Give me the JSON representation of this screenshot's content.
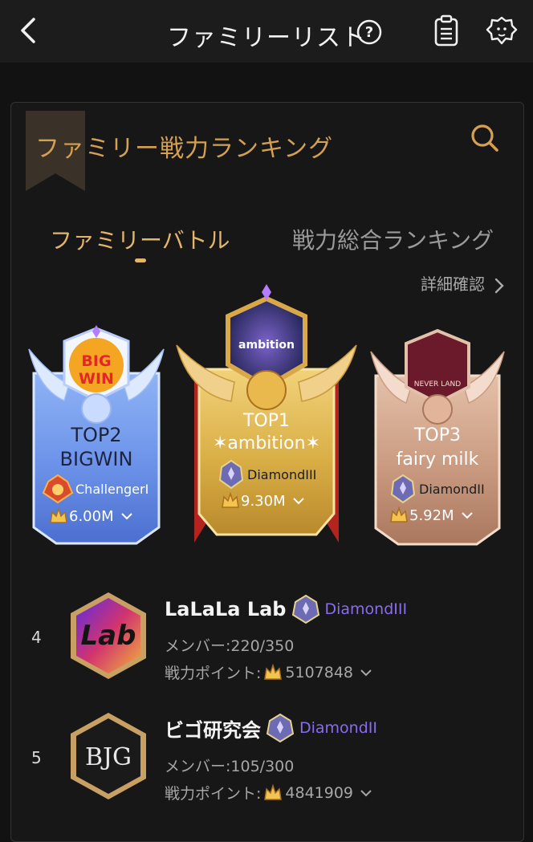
{
  "header": {
    "title": "ファミリーリスト",
    "icons": [
      "back-icon",
      "help-icon",
      "clipboard-icon",
      "lion-icon"
    ]
  },
  "panel": {
    "title": "ファミリー戦力ランキング",
    "tabs": [
      {
        "label": "ファミリーバトル",
        "active": true
      },
      {
        "label": "戦力総合ランキング",
        "active": false
      }
    ],
    "detail_link": "詳細確認"
  },
  "podium": [
    {
      "top": "TOP2",
      "name": "BIGWIN",
      "emblem_text": "BIG WIN",
      "rank": "ChallengerI",
      "power": "6.00M"
    },
    {
      "top": "TOP1",
      "name": "✶ambition✶",
      "emblem_text": "ambition",
      "rank": "DiamondIII",
      "power": "9.30M"
    },
    {
      "top": "TOP3",
      "name": "fairy milk",
      "emblem_text": "NEVER LAND",
      "rank": "DiamondII",
      "power": "5.92M"
    }
  ],
  "list": [
    {
      "position": "4",
      "name": "LaLaLa Lab",
      "logo_text": "Lab",
      "tier": "DiamondIII",
      "members": "メンバー:220/350",
      "points_label": "戦力ポイント:",
      "points": "5107848"
    },
    {
      "position": "5",
      "name": "ビゴ研究会",
      "logo_text": "BJG",
      "tier": "DiamondII",
      "members": "メンバー:105/300",
      "points_label": "戦力ポイント:",
      "points": "4841909"
    }
  ],
  "colors": {
    "gold_accent": "#d4a052",
    "tier_purple": "#8a6cf0",
    "top2_card": "#5a84e0",
    "top1_card": "#d9b352",
    "top3_card": "#c79a83"
  }
}
